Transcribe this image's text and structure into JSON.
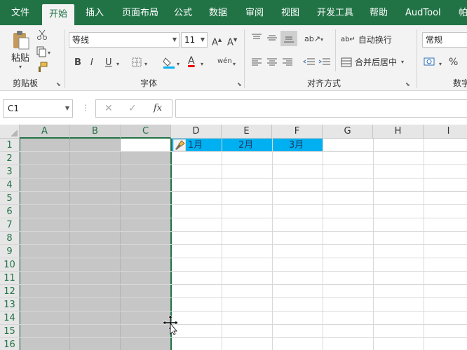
{
  "ribbon_tabs": [
    "文件",
    "开始",
    "插入",
    "页面布局",
    "公式",
    "数据",
    "审阅",
    "视图",
    "开发工具",
    "帮助",
    "AudTool",
    "帕"
  ],
  "active_tab_index": 1,
  "groups": {
    "clipboard": {
      "label": "剪贴板",
      "paste_label": "粘贴"
    },
    "font": {
      "label": "字体",
      "font_name": "等线",
      "font_size": "11",
      "bold": "B",
      "italic": "I",
      "underline": "U"
    },
    "alignment": {
      "label": "对齐方式",
      "wrap_text": "自动换行",
      "merge_center": "合并后居中"
    },
    "number": {
      "label": "数字",
      "format": "常规",
      "percent": "%"
    }
  },
  "formula_bar": {
    "name_box": "C1",
    "fx": "fx",
    "formula": ""
  },
  "columns": [
    "A",
    "B",
    "C",
    "D",
    "E",
    "F",
    "G",
    "H",
    "I"
  ],
  "rows": [
    "1",
    "2",
    "3",
    "4",
    "5",
    "6",
    "7",
    "8",
    "9",
    "10",
    "11",
    "12",
    "13",
    "14",
    "15",
    "16"
  ],
  "cells": {
    "D1": "1月",
    "E1": "2月",
    "F1": "3月"
  },
  "colors": {
    "brand": "#217346",
    "fill_highlight": "#00b0f0",
    "selection_gray": "#c6c6c6"
  }
}
